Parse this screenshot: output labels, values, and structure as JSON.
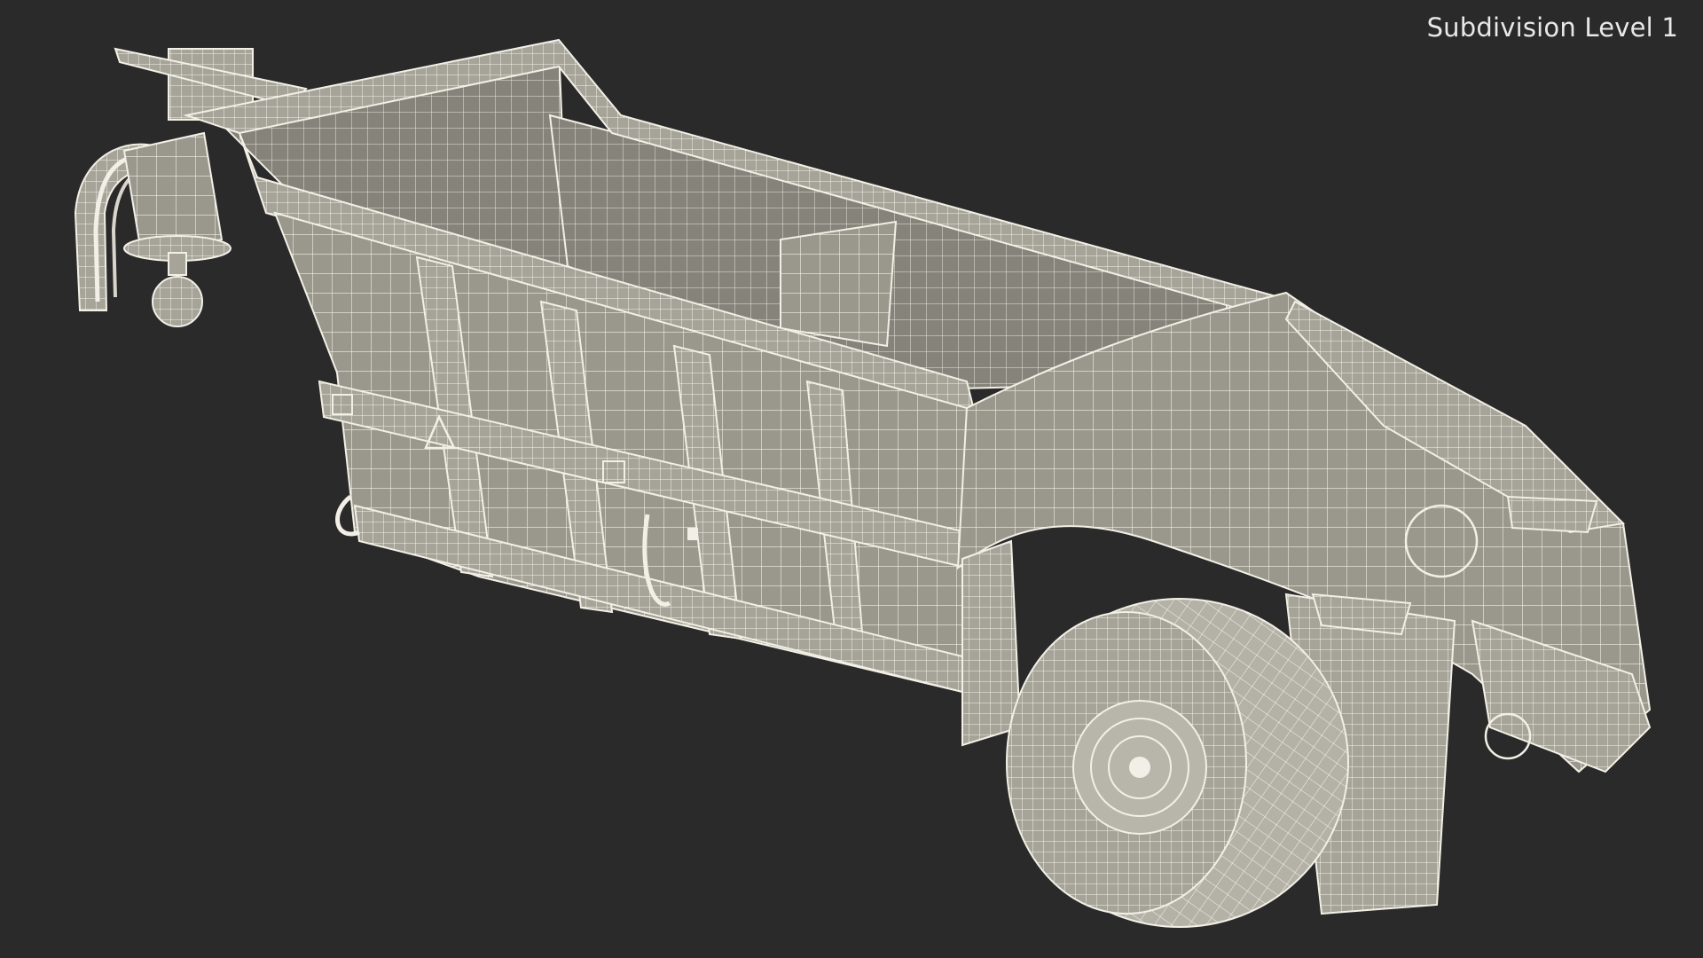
{
  "viewport": {
    "label": "Subdivision Level 1",
    "background_color": "#2a2a2a",
    "model_fill_color": "#9c9a8e",
    "wire_color": "#f2f0e6"
  },
  "model": {
    "subject": "Dump trailer wireframe render",
    "parts": [
      "hitch-icon",
      "dump-body-icon",
      "fender-icon",
      "tire-icon",
      "rear-light-icon",
      "warning-triangle-icon"
    ]
  }
}
